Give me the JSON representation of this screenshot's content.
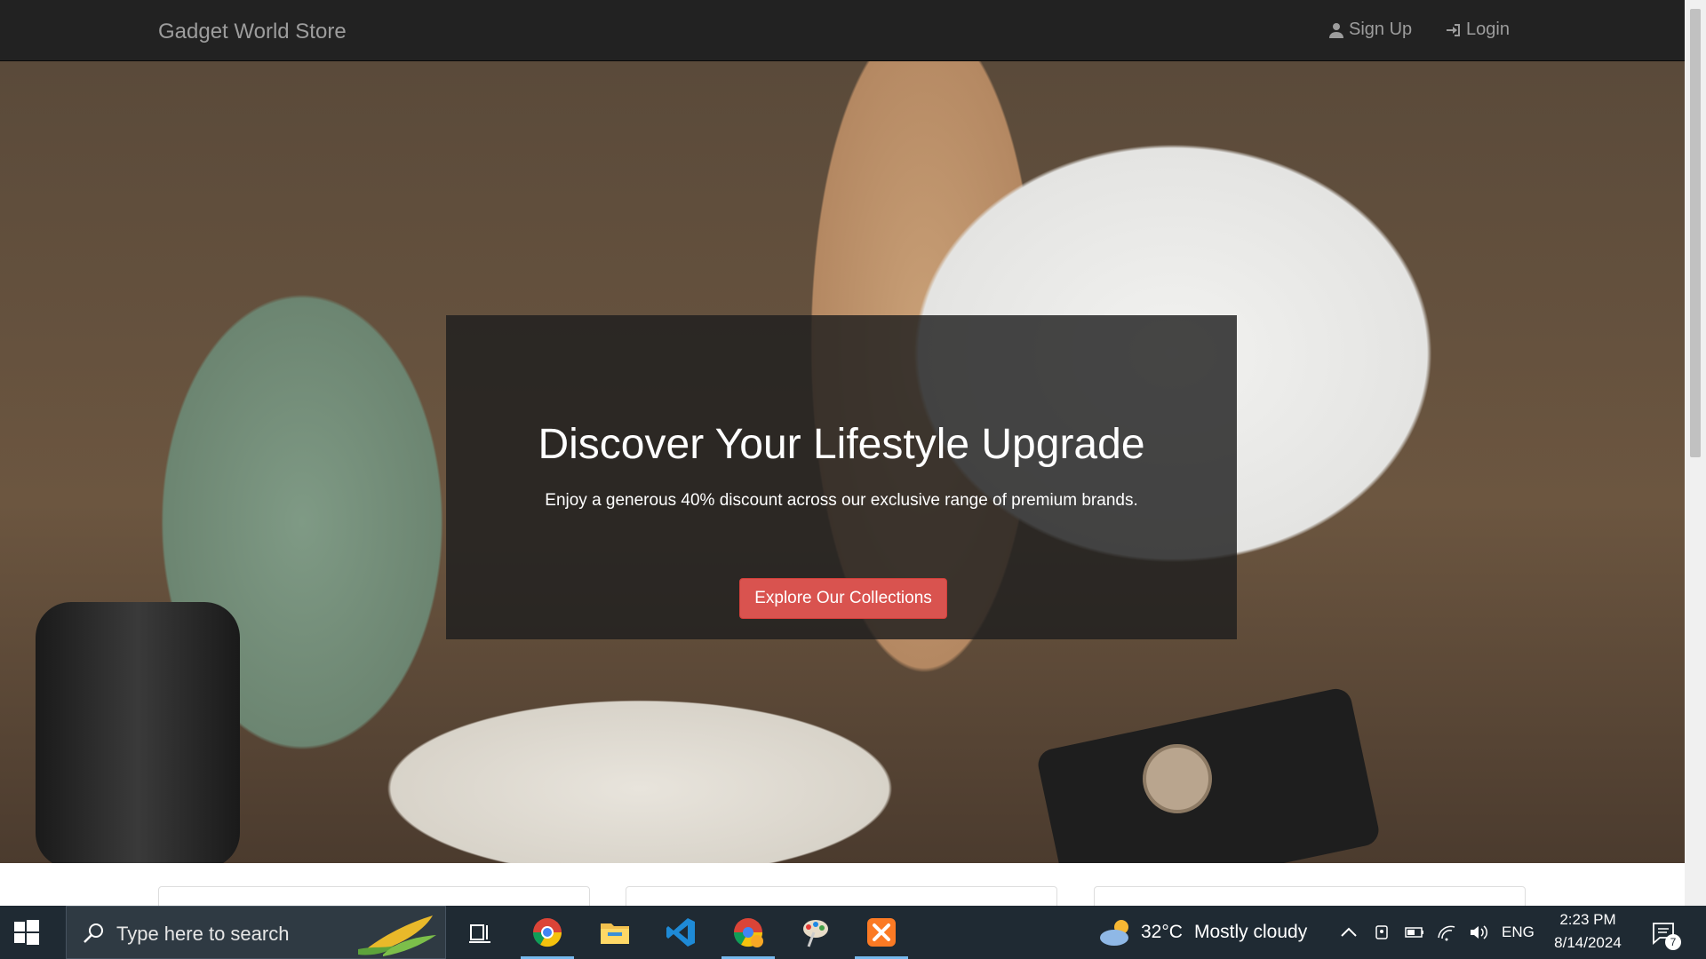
{
  "navbar": {
    "brand": "Gadget World Store",
    "signup_label": "Sign Up",
    "login_label": "Login"
  },
  "hero": {
    "title": "Discover Your Lifestyle Upgrade",
    "subtitle": "Enjoy a generous 40% discount across our exclusive range of premium brands.",
    "cta_label": "Explore Our Collections"
  },
  "taskbar": {
    "search_placeholder": "Type here to search",
    "weather_temp": "32°C",
    "weather_desc": "Mostly cloudy",
    "language": "ENG",
    "time": "2:23 PM",
    "date": "8/14/2024",
    "notification_count": "7",
    "apps": [
      "task-view-icon",
      "chrome-icon",
      "file-explorer-icon",
      "vscode-icon",
      "chrome-canary-icon",
      "paint-icon",
      "xampp-icon"
    ]
  },
  "colors": {
    "navbar_bg": "#222222",
    "cta_bg": "#d9534f",
    "taskbar_bg": "#1f2a33"
  }
}
